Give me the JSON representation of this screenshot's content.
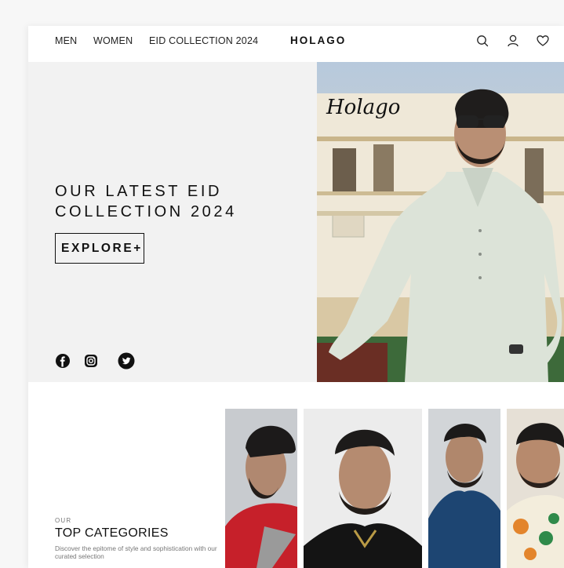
{
  "nav": {
    "links": [
      "MEN",
      "WOMEN",
      "EID COLLECTION 2024"
    ],
    "brand": "HOLAGO",
    "icons": [
      "search-icon",
      "user-icon",
      "heart-icon"
    ]
  },
  "hero": {
    "title_line1": "OUR LATEST EID",
    "title_line2": "COLLECTION 2024",
    "explore_label": "EXPLORE+",
    "script_logo": "Holago",
    "socials": [
      "facebook-icon",
      "instagram-icon",
      "twitter-icon"
    ]
  },
  "categories": {
    "eyebrow": "OUR",
    "title": "TOP CATEGORIES",
    "description": "Discover the epitome of style and sophistication with our curated selection"
  },
  "colors": {
    "hero_bg": "#f2f2f2",
    "text": "#111111",
    "muted": "#777777"
  }
}
